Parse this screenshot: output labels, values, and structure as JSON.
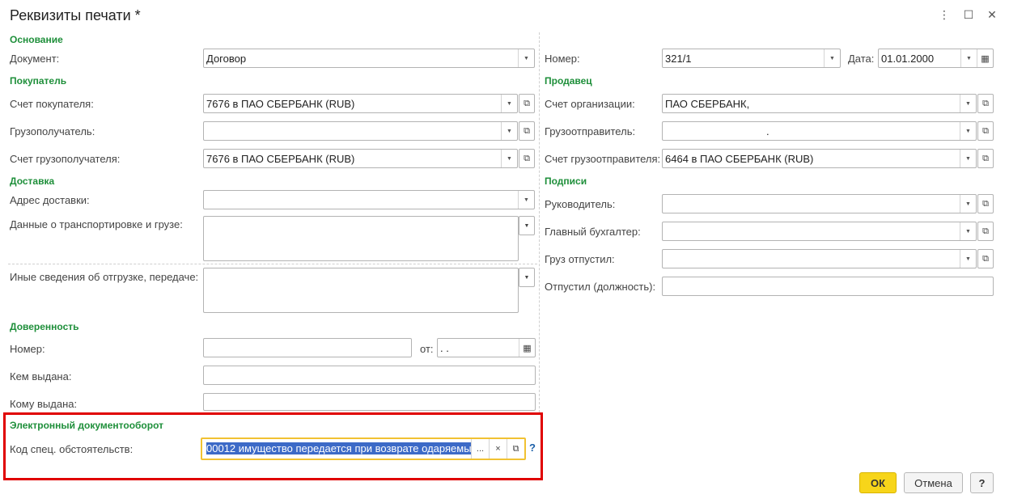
{
  "window": {
    "title": "Реквизиты печати *",
    "more_icon": "⋮",
    "maximize_icon": "☐",
    "close_icon": "✕"
  },
  "left": {
    "basis": {
      "group": "Основание",
      "document_label": "Документ:",
      "document_value": "Договор"
    },
    "buyer": {
      "group": "Покупатель",
      "buyer_account_label": "Счет покупателя:",
      "buyer_account_value": "7676 в ПАО СБЕРБАНК (RUB)",
      "consignee_label": "Грузополучатель:",
      "consignee_value": "",
      "consignee_account_label": "Счет грузополучателя:",
      "consignee_account_value": "7676 в ПАО СБЕРБАНК (RUB)"
    },
    "delivery": {
      "group": "Доставка",
      "address_label": "Адрес доставки:",
      "address_value": "",
      "transport_label": "Данные о транспортировке и грузе:",
      "transport_value": "",
      "other_label": "Иные сведения об отгрузке, передаче:",
      "other_value": ""
    },
    "proxy": {
      "group": "Доверенность",
      "number_label": "Номер:",
      "number_value": "",
      "date_label": "от:",
      "date_value": " .  .",
      "issued_by_label": "Кем выдана:",
      "issued_by_value": "",
      "issued_to_label": "Кому выдана:",
      "issued_to_value": ""
    },
    "edo": {
      "group": "Электронный документооборот",
      "code_label": "Код спец. обстоятельств:",
      "code_value": "00012 имущество передается при возврате одаряемы",
      "help": "?"
    }
  },
  "right": {
    "number_label": "Номер:",
    "number_value": "321/1",
    "date_label": "Дата:",
    "date_value": "01.01.2000",
    "seller": {
      "group": "Продавец",
      "org_account_label": "Счет организации:",
      "org_account_value": "ПАО СБЕРБАНК,",
      "shipper_label": "Грузоотправитель:",
      "shipper_value": ".",
      "shipper_account_label": "Счет грузоотправителя:",
      "shipper_account_value": "6464 в ПАО СБЕРБАНК (RUB)"
    },
    "signatures": {
      "group": "Подписи",
      "director_label": "Руководитель:",
      "director_value": "",
      "accountant_label": "Главный бухгалтер:",
      "accountant_value": "",
      "released_label": "Груз отпустил:",
      "released_value": "",
      "released_position_label": "Отпустил (должность):",
      "released_position_value": ""
    }
  },
  "buttons": {
    "ok": "ОК",
    "cancel": "Отмена",
    "help": "?"
  },
  "icons": {
    "dropdown": "▼",
    "open": "⧉",
    "calendar": "▦",
    "ellipsis": "...",
    "clear": "×"
  },
  "colors": {
    "group_header": "#1e8f3a",
    "ok_button": "#f7d51a",
    "highlight_frame": "#e00000",
    "focus_border": "#f1c232",
    "selection": "#3c6ac7"
  }
}
